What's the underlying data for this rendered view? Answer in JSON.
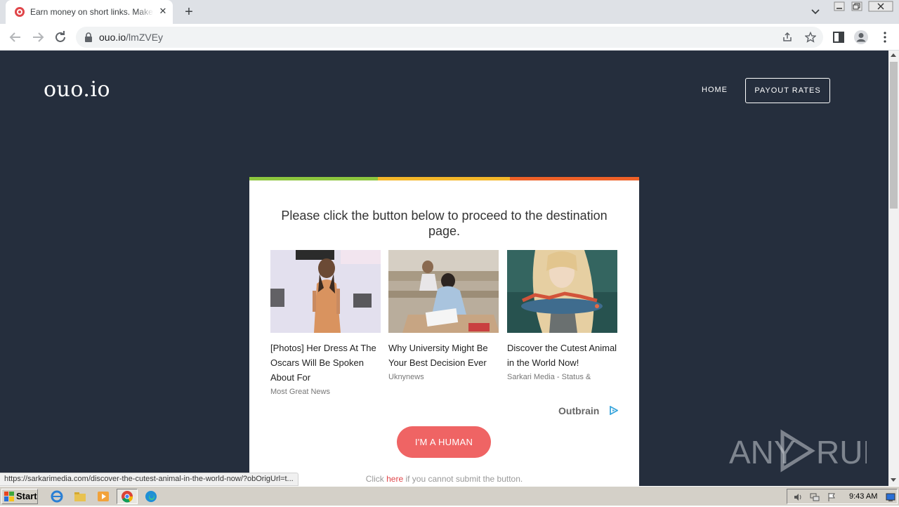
{
  "browser": {
    "tab_title": "Earn money on short links. Make short links and earn the biggest money",
    "url_host": "ouo.io",
    "url_path": "/lmZVEy",
    "status_url": "https://sarkarimedia.com/discover-the-cutest-animal-in-the-world-now/?obOrigUrl=t..."
  },
  "site": {
    "logo": "ouo.io",
    "nav_home": "HOME",
    "nav_payout": "PAYOUT RATES"
  },
  "card": {
    "stripe_colors": [
      "#8dc63f",
      "#f4b72a",
      "#ef6128"
    ],
    "headline": "Please click the button below to proceed to the destination page.",
    "ads": [
      {
        "title": "[Photos] Her Dress At The Oscars Will Be Spoken About For",
        "source": "Most Great News"
      },
      {
        "title": "Why University Might Be Your Best Decision Ever",
        "source": "Uknynews"
      },
      {
        "title": "Discover the Cutest Animal in the World Now!",
        "source": "Sarkari Media - Status &"
      }
    ],
    "outbrain_label": "Outbrain",
    "human_button": "I'M A HUMAN",
    "fallback_prefix": "Click",
    "fallback_link": "here",
    "fallback_suffix": "if you cannot submit the button."
  },
  "watermark": "ANY RUN",
  "taskbar": {
    "start_label": "Start",
    "clock": "9:43 AM"
  },
  "colors": {
    "page_bg": "#252e3d",
    "button": "#ef6464"
  }
}
